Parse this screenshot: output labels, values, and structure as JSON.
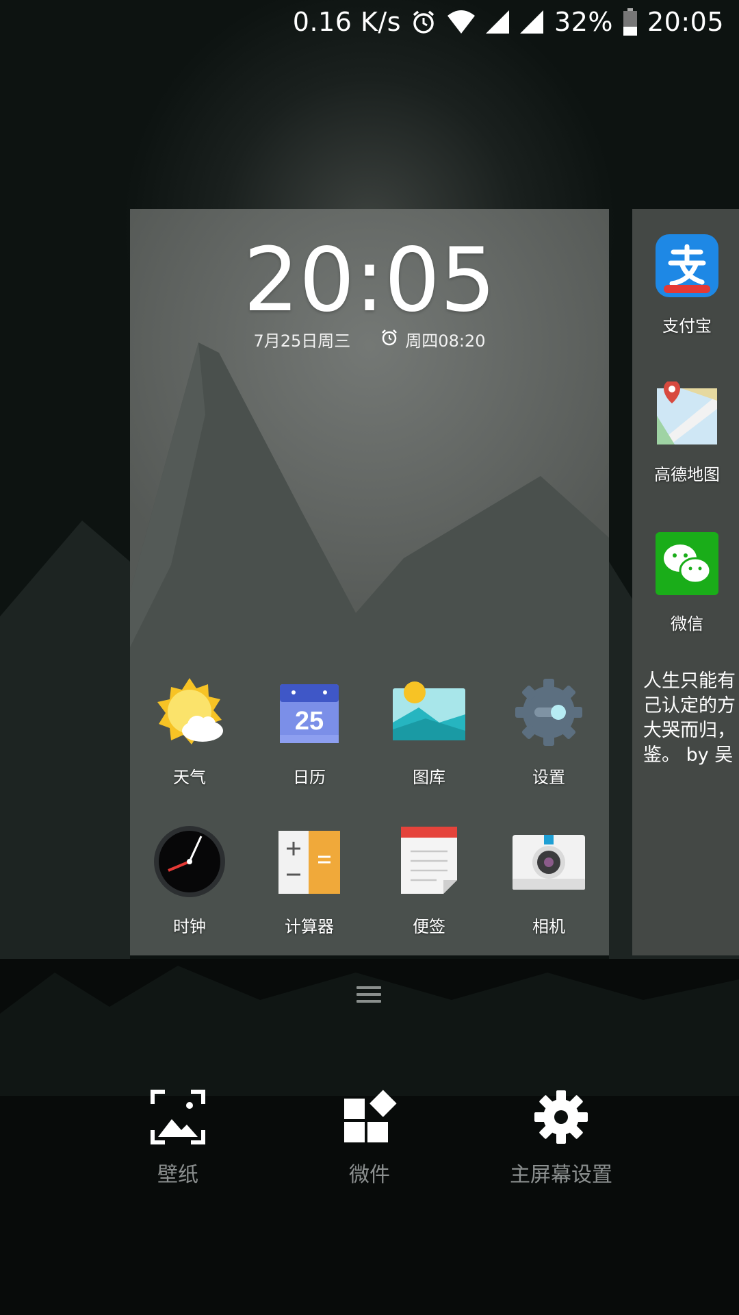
{
  "status_bar": {
    "net_speed": "0.16 K/s",
    "battery": "32%",
    "time": "20:05",
    "icons": [
      "alarm-icon",
      "wifi-icon",
      "signal-icon",
      "signal-icon",
      "battery-icon"
    ]
  },
  "preview": {
    "clock": "20:05",
    "date": "7月25日周三",
    "alarm": "周四08:20",
    "apps_row1": [
      {
        "label": "天气",
        "icon": "weather-icon"
      },
      {
        "label": "日历",
        "icon": "calendar-icon",
        "badge": "25"
      },
      {
        "label": "图库",
        "icon": "gallery-icon"
      },
      {
        "label": "设置",
        "icon": "settings-icon"
      }
    ],
    "apps_row2": [
      {
        "label": "时钟",
        "icon": "clock-icon"
      },
      {
        "label": "计算器",
        "icon": "calculator-icon"
      },
      {
        "label": "便签",
        "icon": "notes-icon"
      },
      {
        "label": "相机",
        "icon": "camera-icon"
      }
    ]
  },
  "side_page": {
    "apps": [
      {
        "label": "支付宝",
        "icon": "alipay-icon"
      },
      {
        "label": "高德地图",
        "icon": "amap-icon"
      },
      {
        "label": "微信",
        "icon": "wechat-icon"
      }
    ],
    "quote": "人生只能有\n己认定的方\n大哭而归，\n鉴。 by 吴"
  },
  "bottom_bar": [
    {
      "label": "壁纸",
      "icon": "wallpaper-icon"
    },
    {
      "label": "微件",
      "icon": "widgets-icon"
    },
    {
      "label": "主屏幕设置",
      "icon": "gear-icon"
    }
  ],
  "colors": {
    "card_bg": "#5d615f",
    "mountain": "#454b48",
    "accent_alipay": "#1e88e5",
    "accent_wechat": "#1aad19"
  }
}
